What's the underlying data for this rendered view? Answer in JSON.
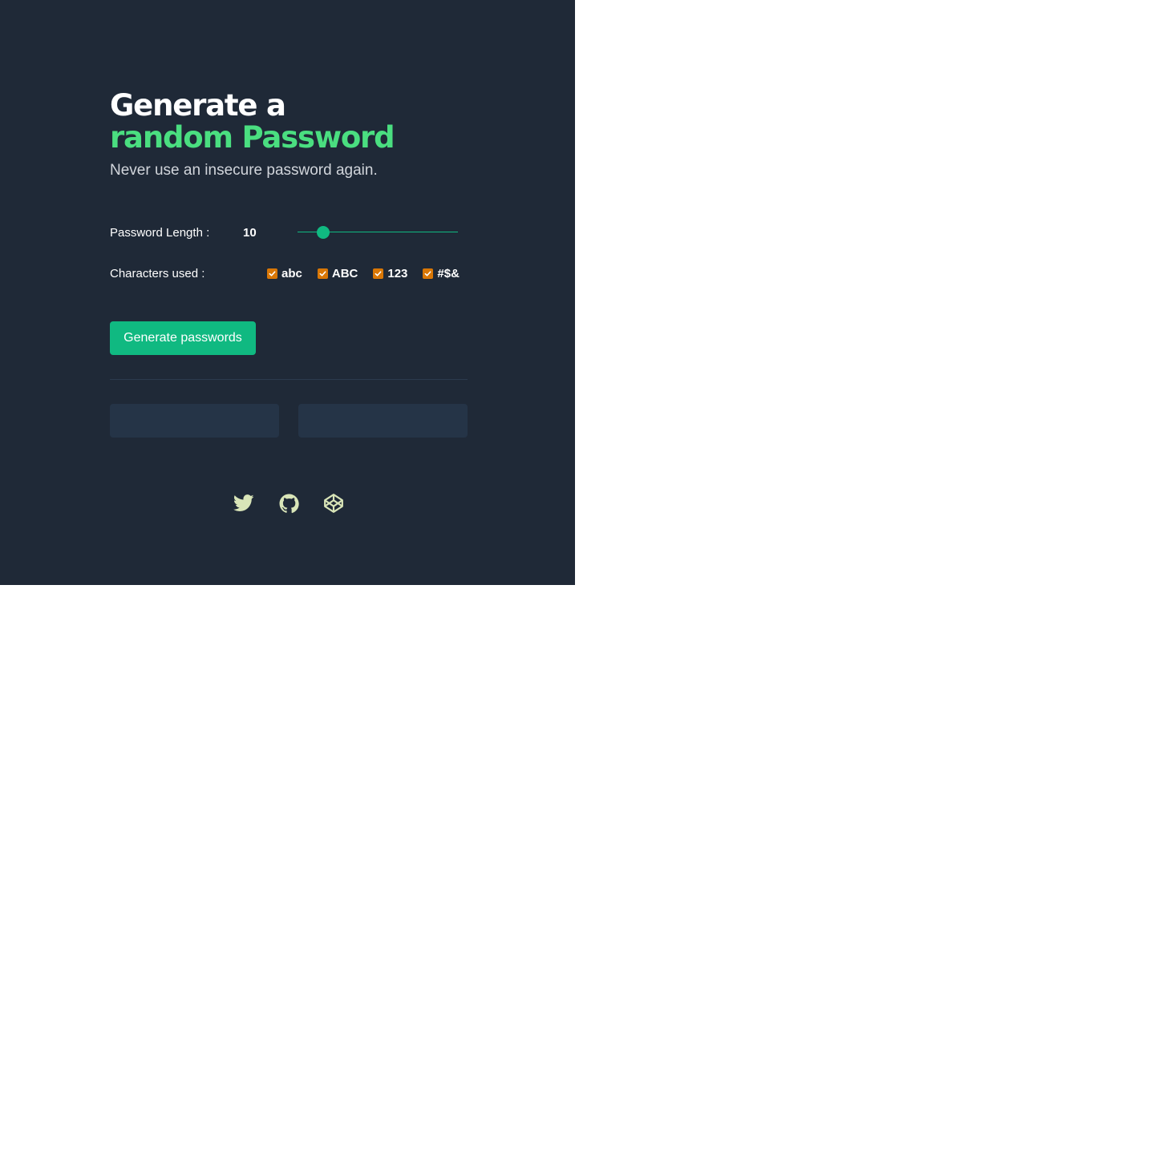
{
  "header": {
    "title_line1": "Generate a",
    "title_line2": "random Password",
    "subtitle": "Never use an insecure password again."
  },
  "length": {
    "label": "Password Length :",
    "value": "10",
    "slider_fraction": 0.16
  },
  "characters": {
    "label": "Characters used :",
    "options": [
      {
        "label": "abc",
        "checked": true
      },
      {
        "label": "ABC",
        "checked": true
      },
      {
        "label": "123",
        "checked": true
      },
      {
        "label": "#$&",
        "checked": true
      }
    ]
  },
  "generate_button": {
    "label": "Generate passwords"
  },
  "outputs": [
    "",
    ""
  ],
  "socials": [
    {
      "icon": "twitter-icon"
    },
    {
      "icon": "github-icon"
    },
    {
      "icon": "codepen-icon"
    }
  ],
  "colors": {
    "background": "#1f2937",
    "accent_green": "#4ade80",
    "button": "#10b981",
    "checkbox": "#d97706",
    "icon": "#d9e5b8"
  }
}
